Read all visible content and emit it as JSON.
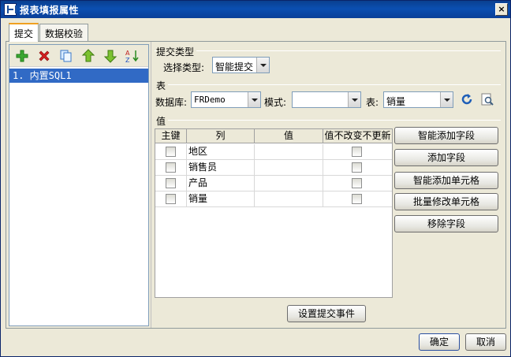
{
  "window": {
    "title": "报表填报属性",
    "close_label": "×"
  },
  "tabs": [
    {
      "label": "提交"
    },
    {
      "label": "数据校验"
    }
  ],
  "list": {
    "items": [
      {
        "label": "1. 内置SQL1"
      }
    ]
  },
  "submit_type": {
    "group_label": "提交类型",
    "select_label": "选择类型:",
    "value": "智能提交"
  },
  "table": {
    "group_label": "表",
    "database_label": "数据库:",
    "database_value": "FRDemo",
    "schema_label": "模式:",
    "schema_value": "",
    "table_label": "表:",
    "table_value": "销量"
  },
  "values": {
    "group_label": "值",
    "columns": [
      "主键",
      "列",
      "值",
      "值不改变不更新"
    ],
    "rows": [
      {
        "column": "地区",
        "value": ""
      },
      {
        "column": "销售员",
        "value": ""
      },
      {
        "column": "产品",
        "value": ""
      },
      {
        "column": "销量",
        "value": ""
      }
    ]
  },
  "side_buttons": {
    "smart_add_field": "智能添加字段",
    "add_field": "添加字段",
    "smart_add_cell": "智能添加单元格",
    "batch_edit_cell": "批量修改单元格",
    "remove_field": "移除字段"
  },
  "submit_event_label": "设置提交事件",
  "footer": {
    "ok_label": "确定",
    "cancel_label": "取消"
  },
  "colors": {
    "title_bar": "#0b4fb1",
    "selection": "#316ac5",
    "dialog_bg": "#ece9d8"
  }
}
